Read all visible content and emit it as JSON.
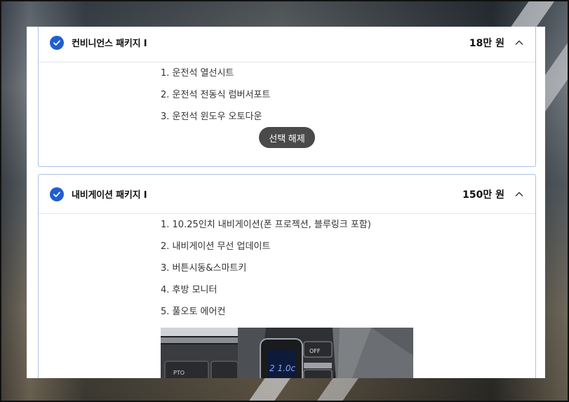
{
  "packages": [
    {
      "title": "컨비니언스 패키지 I",
      "price": "18만 원",
      "items": [
        "1. 운전석 열선시트",
        "2. 운전석 전동식 럼버서포트",
        "3. 운전석 윈도우 오토다운"
      ],
      "deselect_label": "선택 해제"
    },
    {
      "title": "내비게이션 패키지 I",
      "price": "150만 원",
      "items": [
        "1. 10.25인치 내비게이션(폰 프로젝션, 블루링크 포함)",
        "2. 내비게이션 무선 업데이트",
        "3. 버튼시동&스마트키",
        "4. 후방 모니터",
        "5. 풀오토 에어컨"
      ]
    }
  ],
  "photo_labels": {
    "pto": "PTO",
    "off": "OFF",
    "temp": "2 1.0c"
  },
  "colors": {
    "accent": "#1f5fd1",
    "card_border": "#a9c0e6",
    "button_bg": "#4a4a4a"
  }
}
